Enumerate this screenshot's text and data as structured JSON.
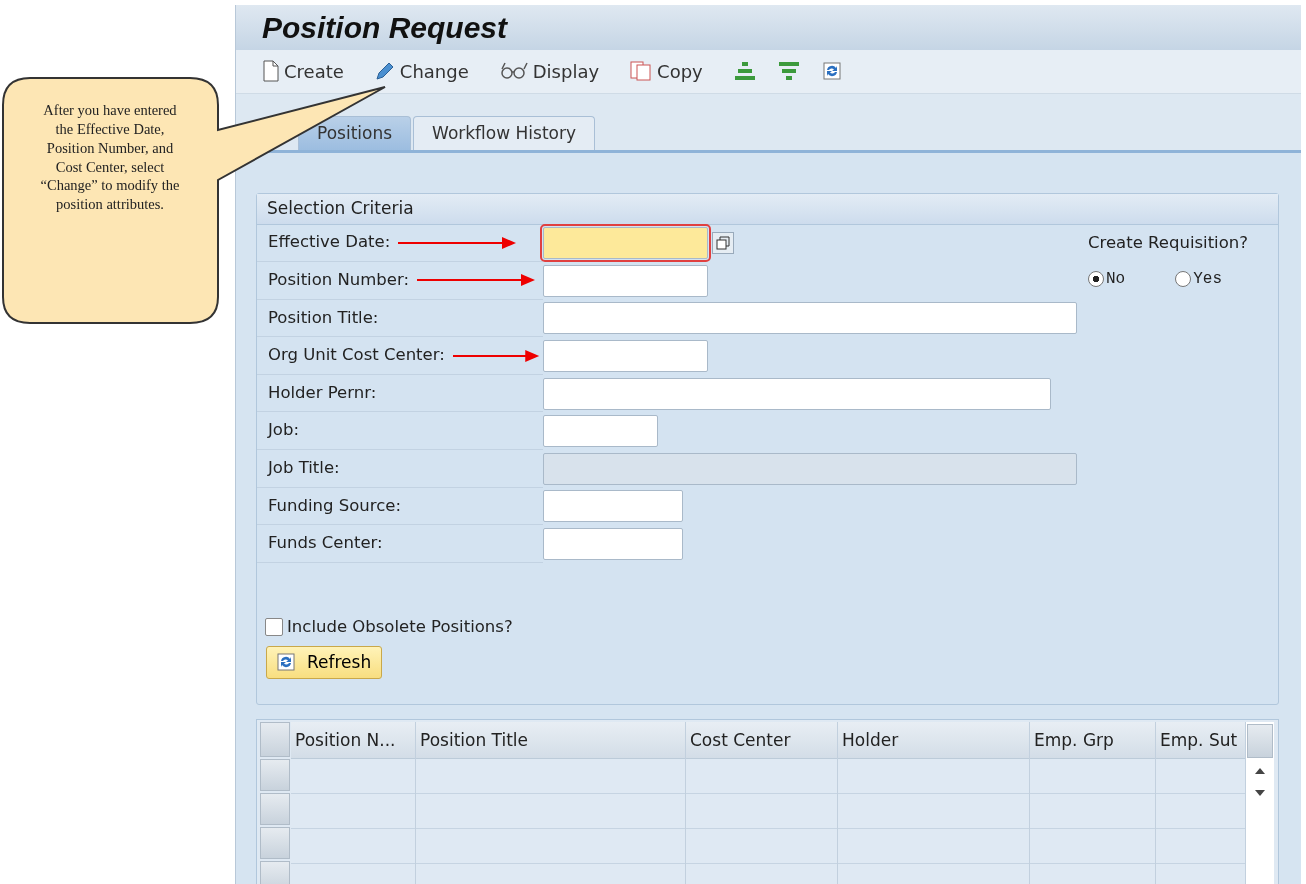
{
  "window": {
    "title": "Position Request"
  },
  "callout": {
    "text": "After you have entered the Effective Date, Position Number, and Cost Center, select “Change” to modify the position attributes."
  },
  "toolbar": [
    {
      "label": "Create",
      "kind": "create"
    },
    {
      "label": "Change",
      "kind": "change"
    },
    {
      "label": "Display",
      "kind": "display"
    },
    {
      "label": "Copy",
      "kind": "copy"
    },
    {
      "kind": "expand"
    },
    {
      "kind": "collapse"
    },
    {
      "kind": "refresh"
    }
  ],
  "tabs": [
    {
      "label": "Positions",
      "selected": true
    },
    {
      "label": "Workflow History",
      "selected": false
    }
  ],
  "selection": {
    "title": "Selection Criteria",
    "fields": [
      {
        "label": "Effective Date:",
        "focused": true,
        "picker": true,
        "disabled": false,
        "arrow": true
      },
      {
        "label": "Position Number:",
        "focused": false,
        "picker": false,
        "disabled": false,
        "arrow": true
      },
      {
        "label": "Position Title:",
        "focused": false,
        "picker": false,
        "disabled": false,
        "arrow": false
      },
      {
        "label": "Org Unit Cost Center:",
        "focused": false,
        "picker": false,
        "disabled": false,
        "arrow": true
      },
      {
        "label": "Holder Pernr:",
        "focused": false,
        "picker": false,
        "disabled": false,
        "arrow": false
      },
      {
        "label": "Job:",
        "focused": false,
        "picker": false,
        "disabled": false,
        "arrow": false
      },
      {
        "label": "Job Title:",
        "focused": false,
        "picker": false,
        "disabled": true,
        "arrow": false
      },
      {
        "label": "Funding Source:",
        "focused": false,
        "picker": false,
        "disabled": false,
        "arrow": false
      },
      {
        "label": "Funds Center:",
        "focused": false,
        "picker": false,
        "disabled": false,
        "arrow": false
      }
    ],
    "requisition": {
      "label": "Create Requisition?",
      "options": [
        {
          "label": "No",
          "selected": true
        },
        {
          "label": "Yes",
          "selected": false
        }
      ]
    },
    "obsolete": {
      "label": "Include Obsolete Positions?",
      "checked": false
    },
    "refresh_button": "Refresh"
  },
  "table": {
    "columns": [
      "Position N...",
      "Position Title",
      "Cost Center",
      "Holder",
      "Emp. Grp",
      "Emp. Sut"
    ]
  }
}
